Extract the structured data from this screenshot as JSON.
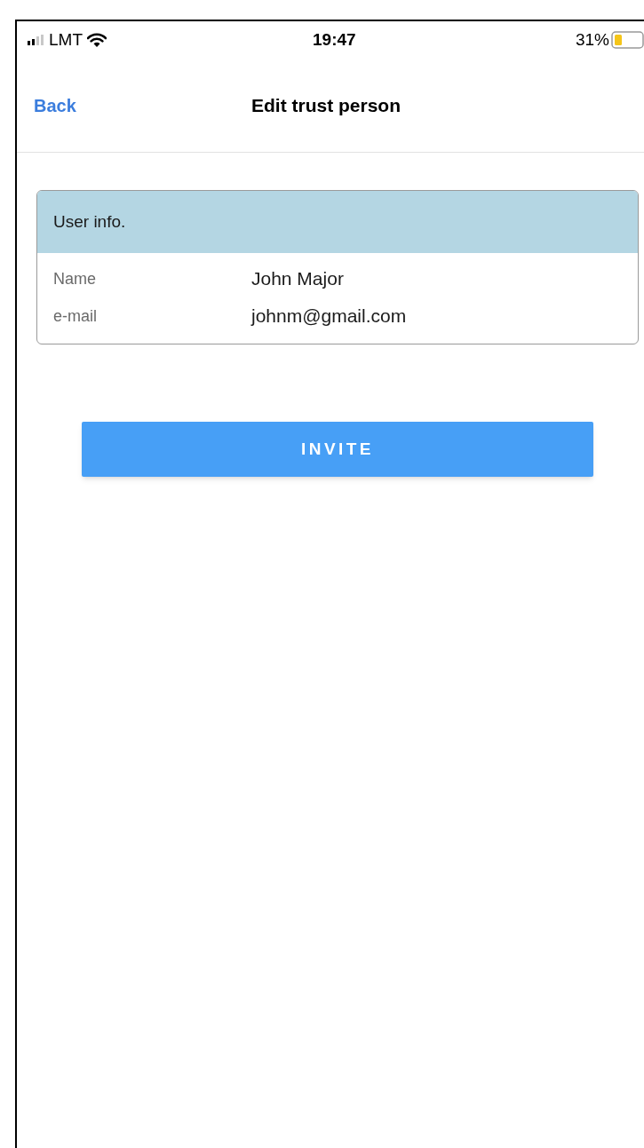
{
  "status_bar": {
    "carrier": "LMT",
    "time": "19:47",
    "battery": "31%"
  },
  "nav": {
    "back": "Back",
    "title": "Edit trust person"
  },
  "card": {
    "title": "User info.",
    "fields": [
      {
        "label": "Name",
        "value": "John Major"
      },
      {
        "label": "e-mail",
        "value": "johnm@gmail.com"
      }
    ]
  },
  "button": "INVITE"
}
